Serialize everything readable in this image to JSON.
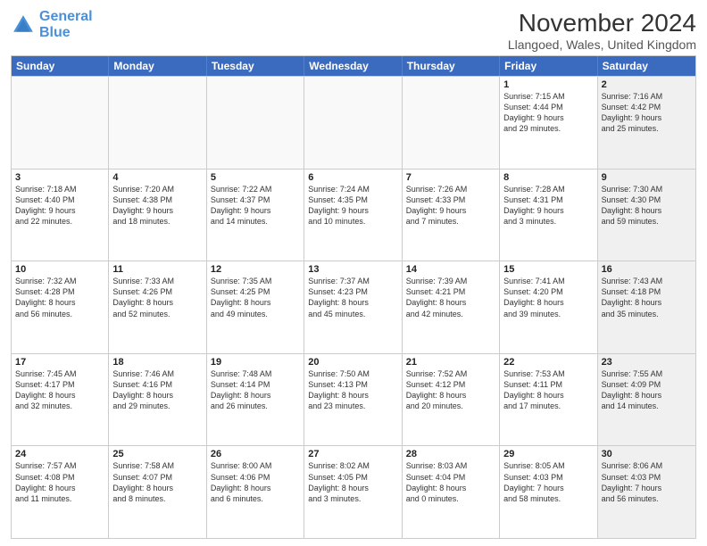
{
  "logo": {
    "line1": "General",
    "line2": "Blue"
  },
  "title": "November 2024",
  "subtitle": "Llangoed, Wales, United Kingdom",
  "headers": [
    "Sunday",
    "Monday",
    "Tuesday",
    "Wednesday",
    "Thursday",
    "Friday",
    "Saturday"
  ],
  "rows": [
    [
      {
        "day": "",
        "info": "",
        "empty": true
      },
      {
        "day": "",
        "info": "",
        "empty": true
      },
      {
        "day": "",
        "info": "",
        "empty": true
      },
      {
        "day": "",
        "info": "",
        "empty": true
      },
      {
        "day": "",
        "info": "",
        "empty": true
      },
      {
        "day": "1",
        "info": "Sunrise: 7:15 AM\nSunset: 4:44 PM\nDaylight: 9 hours\nand 29 minutes.",
        "empty": false
      },
      {
        "day": "2",
        "info": "Sunrise: 7:16 AM\nSunset: 4:42 PM\nDaylight: 9 hours\nand 25 minutes.",
        "empty": false,
        "shaded": true
      }
    ],
    [
      {
        "day": "3",
        "info": "Sunrise: 7:18 AM\nSunset: 4:40 PM\nDaylight: 9 hours\nand 22 minutes.",
        "empty": false
      },
      {
        "day": "4",
        "info": "Sunrise: 7:20 AM\nSunset: 4:38 PM\nDaylight: 9 hours\nand 18 minutes.",
        "empty": false
      },
      {
        "day": "5",
        "info": "Sunrise: 7:22 AM\nSunset: 4:37 PM\nDaylight: 9 hours\nand 14 minutes.",
        "empty": false
      },
      {
        "day": "6",
        "info": "Sunrise: 7:24 AM\nSunset: 4:35 PM\nDaylight: 9 hours\nand 10 minutes.",
        "empty": false
      },
      {
        "day": "7",
        "info": "Sunrise: 7:26 AM\nSunset: 4:33 PM\nDaylight: 9 hours\nand 7 minutes.",
        "empty": false
      },
      {
        "day": "8",
        "info": "Sunrise: 7:28 AM\nSunset: 4:31 PM\nDaylight: 9 hours\nand 3 minutes.",
        "empty": false
      },
      {
        "day": "9",
        "info": "Sunrise: 7:30 AM\nSunset: 4:30 PM\nDaylight: 8 hours\nand 59 minutes.",
        "empty": false,
        "shaded": true
      }
    ],
    [
      {
        "day": "10",
        "info": "Sunrise: 7:32 AM\nSunset: 4:28 PM\nDaylight: 8 hours\nand 56 minutes.",
        "empty": false
      },
      {
        "day": "11",
        "info": "Sunrise: 7:33 AM\nSunset: 4:26 PM\nDaylight: 8 hours\nand 52 minutes.",
        "empty": false
      },
      {
        "day": "12",
        "info": "Sunrise: 7:35 AM\nSunset: 4:25 PM\nDaylight: 8 hours\nand 49 minutes.",
        "empty": false
      },
      {
        "day": "13",
        "info": "Sunrise: 7:37 AM\nSunset: 4:23 PM\nDaylight: 8 hours\nand 45 minutes.",
        "empty": false
      },
      {
        "day": "14",
        "info": "Sunrise: 7:39 AM\nSunset: 4:21 PM\nDaylight: 8 hours\nand 42 minutes.",
        "empty": false
      },
      {
        "day": "15",
        "info": "Sunrise: 7:41 AM\nSunset: 4:20 PM\nDaylight: 8 hours\nand 39 minutes.",
        "empty": false
      },
      {
        "day": "16",
        "info": "Sunrise: 7:43 AM\nSunset: 4:18 PM\nDaylight: 8 hours\nand 35 minutes.",
        "empty": false,
        "shaded": true
      }
    ],
    [
      {
        "day": "17",
        "info": "Sunrise: 7:45 AM\nSunset: 4:17 PM\nDaylight: 8 hours\nand 32 minutes.",
        "empty": false
      },
      {
        "day": "18",
        "info": "Sunrise: 7:46 AM\nSunset: 4:16 PM\nDaylight: 8 hours\nand 29 minutes.",
        "empty": false
      },
      {
        "day": "19",
        "info": "Sunrise: 7:48 AM\nSunset: 4:14 PM\nDaylight: 8 hours\nand 26 minutes.",
        "empty": false
      },
      {
        "day": "20",
        "info": "Sunrise: 7:50 AM\nSunset: 4:13 PM\nDaylight: 8 hours\nand 23 minutes.",
        "empty": false
      },
      {
        "day": "21",
        "info": "Sunrise: 7:52 AM\nSunset: 4:12 PM\nDaylight: 8 hours\nand 20 minutes.",
        "empty": false
      },
      {
        "day": "22",
        "info": "Sunrise: 7:53 AM\nSunset: 4:11 PM\nDaylight: 8 hours\nand 17 minutes.",
        "empty": false
      },
      {
        "day": "23",
        "info": "Sunrise: 7:55 AM\nSunset: 4:09 PM\nDaylight: 8 hours\nand 14 minutes.",
        "empty": false,
        "shaded": true
      }
    ],
    [
      {
        "day": "24",
        "info": "Sunrise: 7:57 AM\nSunset: 4:08 PM\nDaylight: 8 hours\nand 11 minutes.",
        "empty": false
      },
      {
        "day": "25",
        "info": "Sunrise: 7:58 AM\nSunset: 4:07 PM\nDaylight: 8 hours\nand 8 minutes.",
        "empty": false
      },
      {
        "day": "26",
        "info": "Sunrise: 8:00 AM\nSunset: 4:06 PM\nDaylight: 8 hours\nand 6 minutes.",
        "empty": false
      },
      {
        "day": "27",
        "info": "Sunrise: 8:02 AM\nSunset: 4:05 PM\nDaylight: 8 hours\nand 3 minutes.",
        "empty": false
      },
      {
        "day": "28",
        "info": "Sunrise: 8:03 AM\nSunset: 4:04 PM\nDaylight: 8 hours\nand 0 minutes.",
        "empty": false
      },
      {
        "day": "29",
        "info": "Sunrise: 8:05 AM\nSunset: 4:03 PM\nDaylight: 7 hours\nand 58 minutes.",
        "empty": false
      },
      {
        "day": "30",
        "info": "Sunrise: 8:06 AM\nSunset: 4:03 PM\nDaylight: 7 hours\nand 56 minutes.",
        "empty": false,
        "shaded": true
      }
    ]
  ]
}
